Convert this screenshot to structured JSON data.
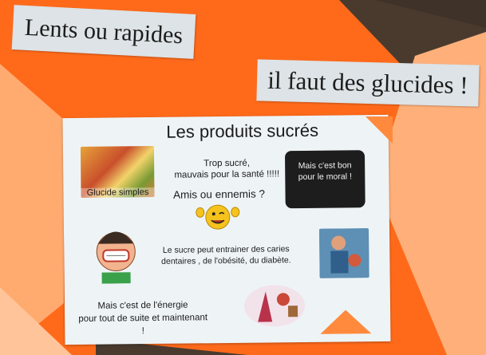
{
  "titles": {
    "line1": "Lents ou rapides",
    "line2": "il faut des glucides !"
  },
  "poster": {
    "heading": "Les produits sucrés",
    "candy_label": "Glucide simples",
    "too_sweet_line1": "Trop sucré,",
    "too_sweet_line2": "mauvais pour la santé !!!!!",
    "friends": "Amis ou ennemis ?",
    "morale_line1": "Mais c'est bon",
    "morale_line2": "pour le moral !",
    "caries_line1": "Le sucre peut entrainer des caries",
    "caries_line2": "dentaires , de l'obésité, du diabète.",
    "energy_line1": "Mais c'est de l'énergie",
    "energy_line2": "pour tout de suite et maintenant !"
  },
  "colors": {
    "background": "#ff6a1a",
    "light_orange": "#ff8a3d",
    "dark_brown": "#4a3a2e",
    "card": "#dde3e6",
    "poster": "#eef4f6"
  }
}
